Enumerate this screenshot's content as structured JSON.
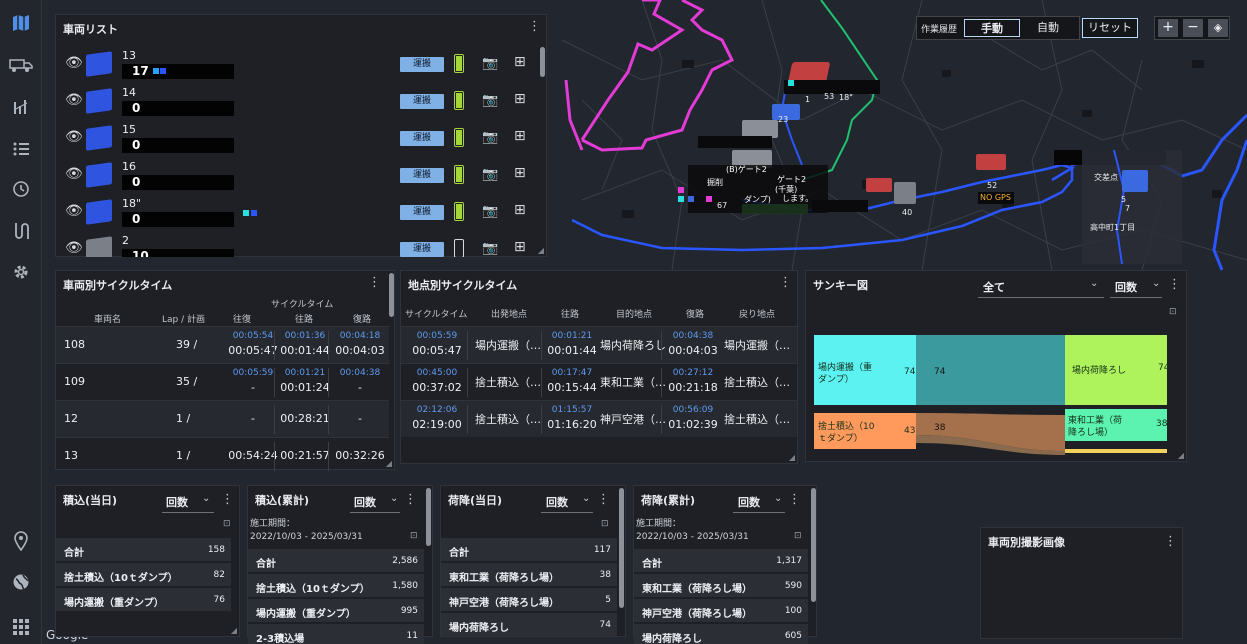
{
  "sidebar": {
    "items": [
      "map-icon",
      "truck-icon",
      "chart-icon",
      "list-icon",
      "history-icon",
      "route-icon",
      "gear-icon",
      "location-pin-icon",
      "globe-icon",
      "apps-grid-icon"
    ]
  },
  "map": {
    "history_label": "作業履歴",
    "manual": "手動",
    "auto": "自動",
    "reset": "リセット",
    "zoom_in": "+",
    "zoom_out": "−",
    "layers": "◈",
    "labels": {
      "gate2a": "(B)ゲート2",
      "gate2b": "ゲート2",
      "cuts": "掘削",
      "dump": "ダンプ)",
      "chiba": "(千葉)",
      "remove": "します。",
      "kouban": "交差点",
      "mappin": "高中町1丁目",
      "no_gps": "NO GPS",
      "n52": "52",
      "n40": "40",
      "n23": "23",
      "n53": "53",
      "n18": "18\"",
      "n1": "1",
      "n7": "7",
      "n5": "5",
      "n67": "67"
    }
  },
  "vehicle_list": {
    "title": "車両リスト",
    "status_label": "運搬",
    "vehicles": [
      {
        "name": "13",
        "plate": "17",
        "battery": 1.0
      },
      {
        "name": "14",
        "plate": "0",
        "battery": 1.0
      },
      {
        "name": "15",
        "plate": "0",
        "battery": 1.0
      },
      {
        "name": "16",
        "plate": "0",
        "battery": 1.0
      },
      {
        "name": "18\"",
        "plate": "0",
        "battery": 1.0
      },
      {
        "name": "2",
        "plate": "10",
        "battery": 0.0
      }
    ]
  },
  "cycle_vehicle": {
    "title": "車両別サイクルタイム",
    "group": "サイクルタイム",
    "headers": [
      "車両名",
      "Lap / 計画",
      "往復",
      "往路",
      "復路"
    ],
    "rows": [
      {
        "name": "108",
        "lap": "39 /",
        "rt_plan": "00:05:54",
        "rt": "00:05:47",
        "go_plan": "00:01:36",
        "go": "00:01:44",
        "back_plan": "00:04:18",
        "back": "00:04:03"
      },
      {
        "name": "109",
        "lap": "35 /",
        "rt_plan": "00:05:59",
        "rt": "-",
        "go_plan": "00:01:21",
        "go": "00:01:24",
        "back_plan": "00:04:38",
        "back": "-"
      },
      {
        "name": "12",
        "lap": "1 /",
        "rt_plan": "",
        "rt": "-",
        "go_plan": "",
        "go": "00:28:21",
        "back_plan": "",
        "back": "-"
      },
      {
        "name": "13",
        "lap": "1 /",
        "rt_plan": "",
        "rt": "00:54:24",
        "go_plan": "",
        "go": "00:21:57",
        "back_plan": "",
        "back": "00:32:26"
      }
    ]
  },
  "cycle_site": {
    "title": "地点別サイクルタイム",
    "headers": [
      "サイクルタイム",
      "出発地点",
      "往路",
      "目的地点",
      "復路",
      "戻り地点"
    ],
    "rows": [
      {
        "ct_plan": "00:05:59",
        "ct": "00:05:47",
        "from": "場内運搬（…",
        "go_plan": "00:01:21",
        "go": "00:01:44",
        "to": "場内荷降ろし",
        "back_plan": "00:04:38",
        "back": "00:04:03",
        "ret": "場内運搬（…"
      },
      {
        "ct_plan": "00:45:00",
        "ct": "00:37:02",
        "from": "捨土積込（…",
        "go_plan": "00:17:47",
        "go": "00:15:44",
        "to": "東和工業（…",
        "back_plan": "00:27:12",
        "back": "00:21:18",
        "ret": "捨土積込（…"
      },
      {
        "ct_plan": "02:12:06",
        "ct": "02:19:00",
        "from": "捨土積込（…",
        "go_plan": "01:15:57",
        "go": "01:16:20",
        "to": "神戸空港（…",
        "back_plan": "00:56:09",
        "back": "01:02:39",
        "ret": "捨土積込（…"
      }
    ]
  },
  "sankey": {
    "title": "サンキー図",
    "filter": "全て",
    "metric": "回数",
    "left_nodes": [
      {
        "label1": "場内運搬（重",
        "label2": "ダンプ）",
        "value": "74",
        "color": "#5cf2f2"
      },
      {
        "label1": "捨土積込（10",
        "label2": "ｔダンプ）",
        "value": "43",
        "color": "#ff9a5c"
      }
    ],
    "flows": [
      "74",
      "38"
    ],
    "right_nodes": [
      {
        "label1": "場内荷降ろし",
        "label2": "",
        "value": "74",
        "color": "#aef25c"
      },
      {
        "label1": "東和工業（荷",
        "label2": "降ろし場）",
        "value": "38",
        "color": "#5cf2b0"
      }
    ]
  },
  "load_today": {
    "title": "積込(当日)",
    "metric": "回数",
    "rows": [
      {
        "label": "合計",
        "value": "158"
      },
      {
        "label": "捨土積込（10ｔダンプ）",
        "value": "82"
      },
      {
        "label": "場内運搬（重ダンプ）",
        "value": "76"
      }
    ]
  },
  "load_total": {
    "title": "積込(累計)",
    "metric": "回数",
    "period_label": "施工期間：",
    "period": "2022/10/03 - 2025/03/31",
    "rows": [
      {
        "label": "合計",
        "value": "2,586"
      },
      {
        "label": "捨土積込（10ｔダンプ）",
        "value": "1,580"
      },
      {
        "label": "場内運搬（重ダンプ）",
        "value": "995"
      },
      {
        "label": "2-3積込場",
        "value": "11"
      }
    ]
  },
  "unload_today": {
    "title": "荷降(当日)",
    "metric": "回数",
    "rows": [
      {
        "label": "合計",
        "value": "117"
      },
      {
        "label": "東和工業（荷降ろし場）",
        "value": "38"
      },
      {
        "label": "神戸空港（荷降ろし場）",
        "value": "5"
      },
      {
        "label": "場内荷降ろし",
        "value": "74"
      }
    ]
  },
  "unload_total": {
    "title": "荷降(累計)",
    "metric": "回数",
    "period_label": "施工期間：",
    "period": "2022/10/03 - 2025/03/31",
    "rows": [
      {
        "label": "合計",
        "value": "1,317"
      },
      {
        "label": "東和工業（荷降ろし場）",
        "value": "590"
      },
      {
        "label": "神戸空港（荷降ろし場）",
        "value": "100"
      },
      {
        "label": "場内荷降ろし",
        "value": "605"
      }
    ]
  },
  "photos": {
    "title": "車両別撮影画像"
  },
  "footer": {
    "google": "Google"
  }
}
